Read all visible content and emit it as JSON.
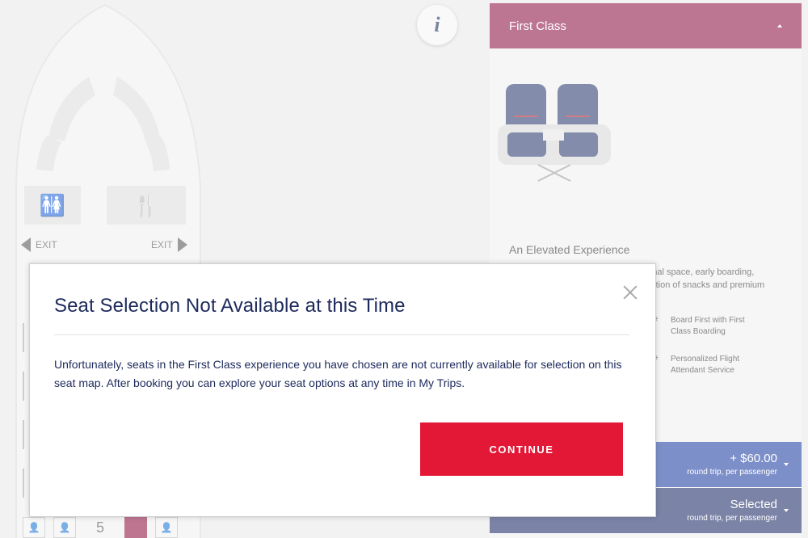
{
  "seatmap": {
    "info_label": "i",
    "exit_left": "EXIT",
    "exit_right": "EXIT",
    "row_number": "5"
  },
  "panel": {
    "cabin_title": "First Class",
    "experience_title": "An Elevated Experience",
    "experience_desc": "Arrive relaxed and enjoy more personal space, early boarding, personalized service and a free selection of snacks and premium",
    "features": [
      {
        "icon": "boarding-icon",
        "text": "Board First with First Class Boarding"
      },
      {
        "icon": "service-icon",
        "text": "Personalized Flight Attendant Service"
      }
    ],
    "price": {
      "amount": "+ $60.00",
      "sub": "round trip, per passenger"
    },
    "selected": {
      "label": "Selected",
      "sub": "round trip, per passenger"
    }
  },
  "modal": {
    "title": "Seat Selection Not Available at this Time",
    "body_pre": "Unfortunately, seats in the ",
    "body_highlight": "First Class",
    "body_post": " experience you have chosen are not currently available for selection on this seat map. After booking you can explore your seat options at any time in My Trips.",
    "continue_label": "CONTINUE"
  },
  "colors": {
    "brand_navy": "#1d2a5c",
    "first_class": "#8e1444",
    "cta_red": "#e31836",
    "price_blue": "#1f3ea3"
  }
}
